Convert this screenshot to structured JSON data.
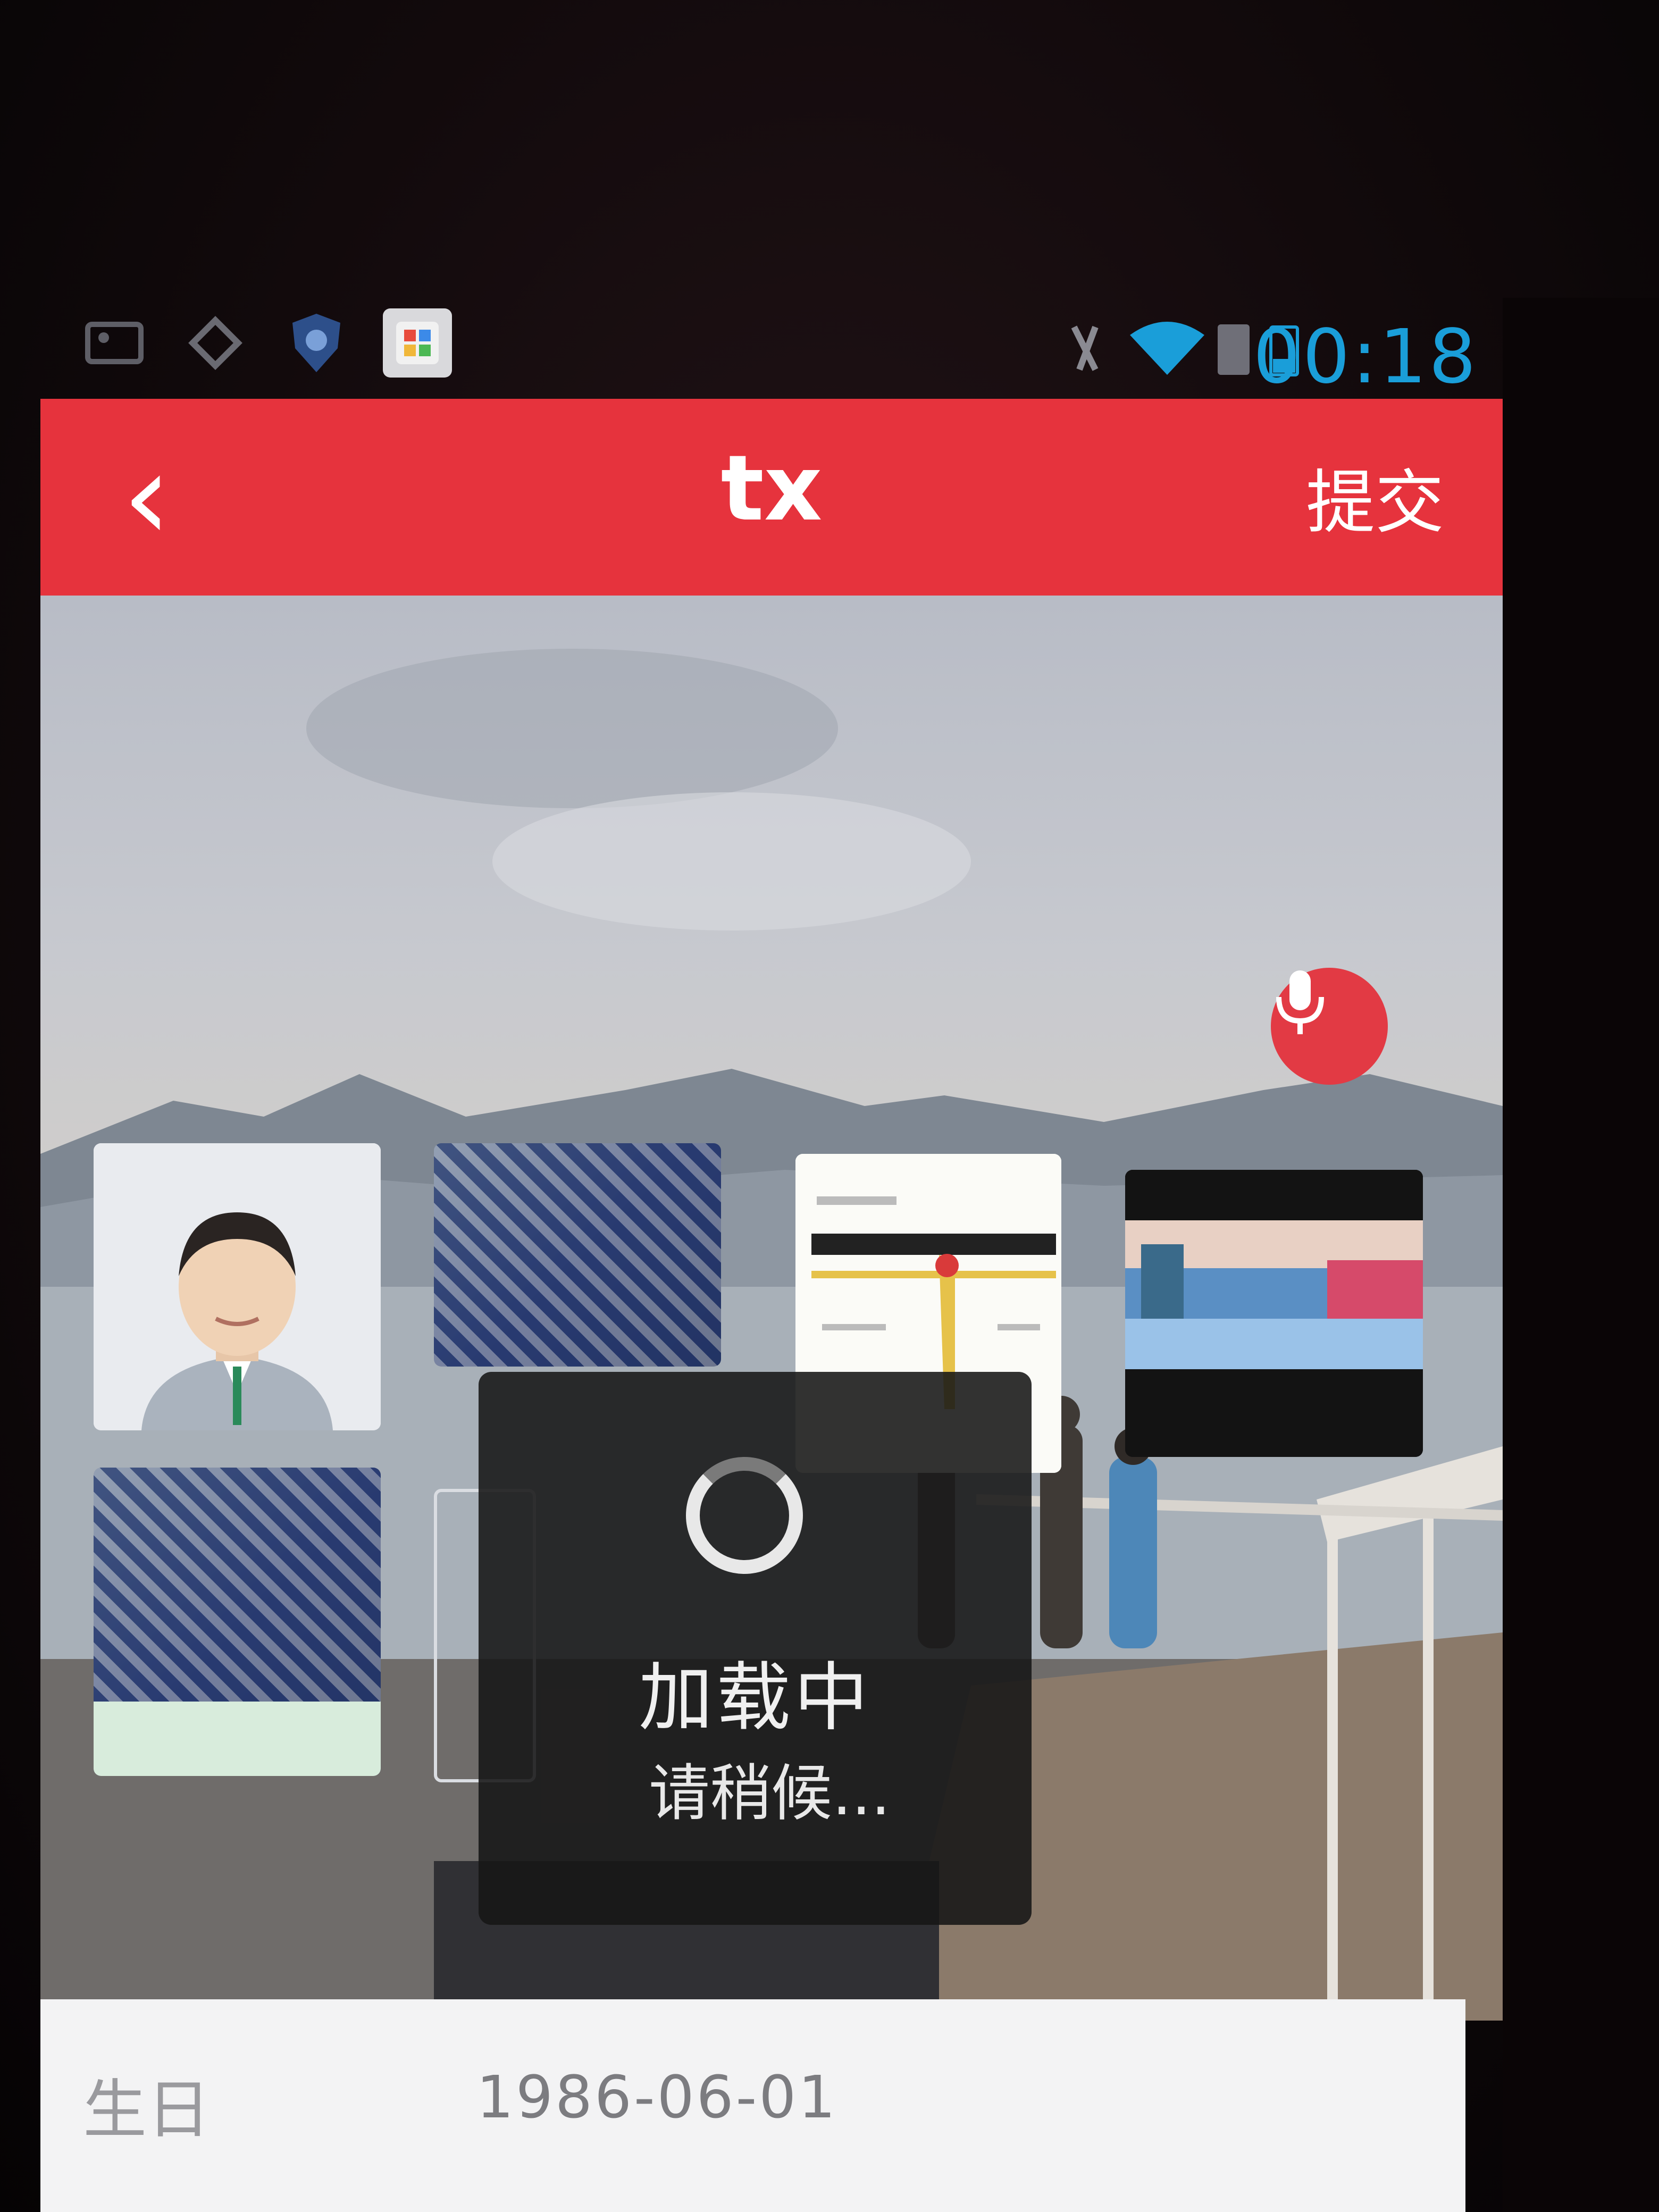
{
  "status_bar": {
    "left_icons": [
      "image-icon",
      "settings-icon",
      "shield-icon",
      "app-icon"
    ],
    "right_icons": [
      "silent-icon",
      "wifi-icon",
      "sim-icon",
      "battery-icon"
    ],
    "time": "00:18"
  },
  "action_bar": {
    "back_label": "‹",
    "title": "tx",
    "submit_label": "提交",
    "color": "#e6333d"
  },
  "loading": {
    "title": "加载中",
    "message": "请稍候..."
  },
  "form": {
    "birthday_label": "生日",
    "birthday_value": "1986-06-01"
  },
  "colors": {
    "accent": "#e6333d",
    "clock": "#1a9ed9"
  }
}
